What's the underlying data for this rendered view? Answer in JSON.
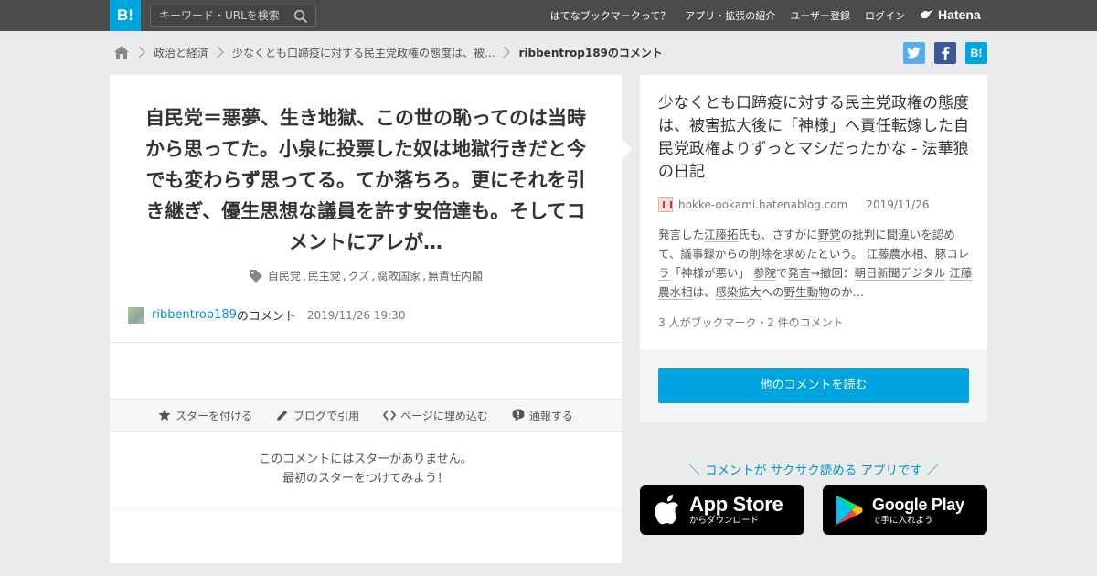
{
  "header": {
    "logo_text": "B!",
    "search_placeholder": "キーワード・URLを検索",
    "nav": [
      "はてなブックマークって？",
      "アプリ・拡張の紹介",
      "ユーザー登録",
      "ログイン"
    ],
    "hatena_label": "Hatena"
  },
  "breadcrumb": {
    "items": [
      "政治と経済",
      "少なくとも口蹄疫に対する民主党政権の態度は、被..."
    ],
    "current": "ribbentrop189のコメント"
  },
  "share": {
    "bookmark_label": "B!"
  },
  "comment": {
    "text": "自民党＝悪夢、生き地獄、この世の恥ってのは当時から思ってた。小泉に投票した奴は地獄行きだと今でも変わらず思ってる。てか落ちろ。更にそれを引き継ぎ、優生思想な議員を許す安倍達も。そしてコメントにアレが…",
    "tags": [
      "自民党",
      "民主党",
      "クズ",
      "腐敗国家",
      "無責任内閣"
    ],
    "username": "ribbentrop189",
    "username_suffix": "のコメント",
    "timestamp": "2019/11/26 19:30"
  },
  "actions": {
    "star": "スターを付ける",
    "blog": "ブログで引用",
    "embed": "ページに埋め込む",
    "report": "通報する"
  },
  "stars": {
    "line1": "このコメントにはスターがありません。",
    "line2": "最初のスターをつけてみよう！"
  },
  "article": {
    "title": "少なくとも口蹄疫に対する民主党政権の態度は、被害拡大後に「神様」へ責任転嫁した自民党政権よりずっとマシだったかな - 法華狼の日記",
    "domain": "hokke-ookami.hatenablog.com",
    "date": "2019/11/26",
    "desc_1": "発言した",
    "desc_link_1": "江藤拓",
    "desc_2": "氏も、さすがに",
    "desc_link_2": "野党",
    "desc_3": "の批判に間違いを認めて、",
    "desc_link_3": "議事録",
    "desc_4": "からの削除を求めたという。",
    "desc_link_4": "江藤農水相",
    "desc_5": "、",
    "desc_link_5": "豚コレラ",
    "desc_6": "「神様が悪い」",
    "desc_link_6": "参院",
    "desc_7": "で",
    "desc_link_7": "発言",
    "desc_8": "→撤回：",
    "desc_link_8": "朝日新聞デジタル",
    "desc_9": " ",
    "desc_link_9": "江藤農水相",
    "desc_10": "は、",
    "desc_link_10": "感染拡大",
    "desc_11": "への",
    "desc_link_11": "野生動物",
    "desc_12": "のか…",
    "count": "3 人がブックマーク・2 件のコメント"
  },
  "read_button": "他のコメントを読む",
  "app_promo": "＼ コメントが サクサク読める アプリです ／",
  "app_store": {
    "big": "App Store",
    "small": "からダウンロード"
  },
  "google_play": {
    "big": "Google Play",
    "small": "で手に入れよう"
  },
  "colors": {
    "brand": "#00a4de",
    "header_bg": "#4b4b4b",
    "twitter": "#55acee",
    "facebook": "#3b5998"
  }
}
